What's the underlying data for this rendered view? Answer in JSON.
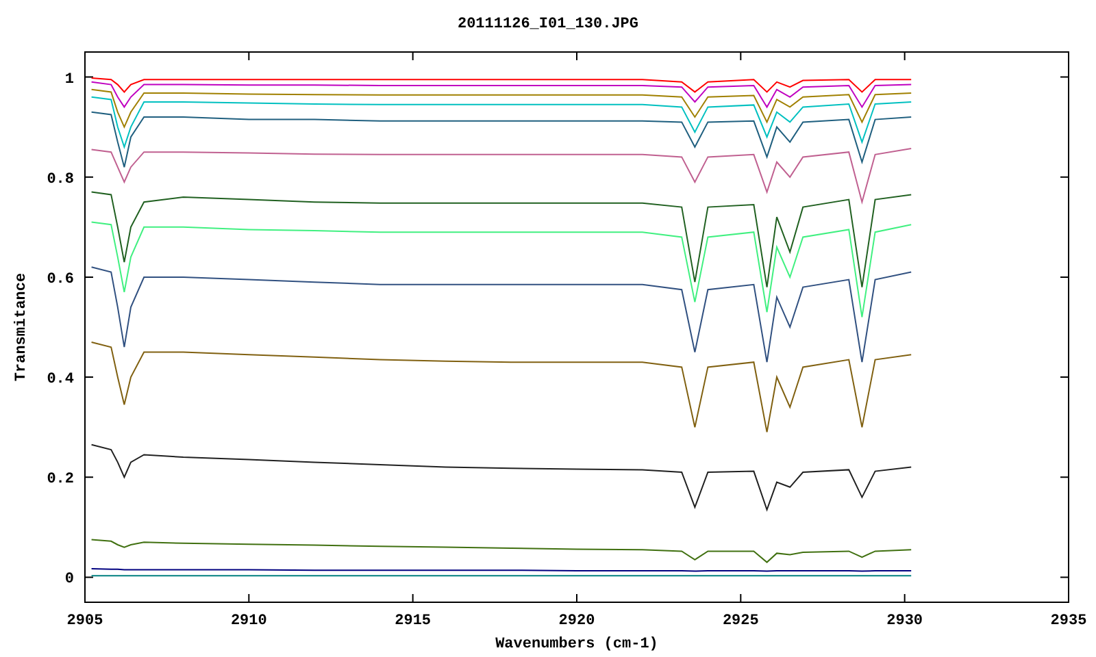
{
  "chart_data": {
    "type": "line",
    "title": "20111126_I01_130.JPG",
    "xlabel": "Wavenumbers (cm-1)",
    "ylabel": "Transmitance",
    "xlim": [
      2905,
      2935
    ],
    "ylim": [
      -0.05,
      1.05
    ],
    "xticks": [
      2905,
      2910,
      2915,
      2920,
      2925,
      2930,
      2935
    ],
    "yticks": [
      {
        "value": 0,
        "label": "0"
      },
      {
        "value": 0.2,
        "label": "0.2"
      },
      {
        "value": 0.4,
        "label": "0.4"
      },
      {
        "value": 0.6,
        "label": "0.6"
      },
      {
        "value": 0.8,
        "label": "0.8"
      },
      {
        "value": 1,
        "label": "1"
      }
    ],
    "x": [
      2905.2,
      2905.8,
      2906.0,
      2906.2,
      2906.4,
      2906.8,
      2908,
      2910,
      2912,
      2914,
      2916,
      2918,
      2920,
      2922,
      2923.2,
      2923.6,
      2924.0,
      2925.4,
      2925.8,
      2926.1,
      2926.5,
      2926.9,
      2928.3,
      2928.7,
      2929.1,
      2930.2
    ],
    "series": [
      {
        "color": "#ff0000",
        "values": [
          0.998,
          0.995,
          0.985,
          0.97,
          0.985,
          0.995,
          0.995,
          0.995,
          0.995,
          0.995,
          0.995,
          0.995,
          0.995,
          0.995,
          0.99,
          0.97,
          0.99,
          0.995,
          0.97,
          0.99,
          0.98,
          0.993,
          0.995,
          0.97,
          0.995,
          0.995
        ]
      },
      {
        "color": "#c000c0",
        "values": [
          0.99,
          0.985,
          0.96,
          0.94,
          0.96,
          0.985,
          0.985,
          0.984,
          0.984,
          0.983,
          0.983,
          0.983,
          0.983,
          0.983,
          0.98,
          0.95,
          0.98,
          0.983,
          0.94,
          0.975,
          0.96,
          0.98,
          0.983,
          0.94,
          0.983,
          0.985
        ]
      },
      {
        "color": "#a08000",
        "values": [
          0.975,
          0.97,
          0.93,
          0.9,
          0.93,
          0.968,
          0.968,
          0.966,
          0.965,
          0.964,
          0.964,
          0.964,
          0.964,
          0.964,
          0.96,
          0.92,
          0.96,
          0.963,
          0.91,
          0.955,
          0.94,
          0.96,
          0.965,
          0.91,
          0.965,
          0.968
        ]
      },
      {
        "color": "#00c0c0",
        "values": [
          0.96,
          0.955,
          0.9,
          0.86,
          0.9,
          0.95,
          0.95,
          0.948,
          0.946,
          0.945,
          0.945,
          0.945,
          0.945,
          0.945,
          0.94,
          0.89,
          0.94,
          0.944,
          0.88,
          0.93,
          0.91,
          0.94,
          0.946,
          0.87,
          0.946,
          0.95
        ]
      },
      {
        "color": "#1f5f7f",
        "values": [
          0.93,
          0.925,
          0.87,
          0.82,
          0.88,
          0.92,
          0.92,
          0.915,
          0.915,
          0.912,
          0.912,
          0.912,
          0.912,
          0.912,
          0.91,
          0.86,
          0.91,
          0.912,
          0.84,
          0.9,
          0.87,
          0.91,
          0.915,
          0.83,
          0.915,
          0.92
        ]
      },
      {
        "color": "#c06090",
        "values": [
          0.855,
          0.85,
          0.82,
          0.79,
          0.82,
          0.85,
          0.85,
          0.848,
          0.846,
          0.845,
          0.845,
          0.845,
          0.845,
          0.845,
          0.84,
          0.79,
          0.84,
          0.845,
          0.77,
          0.83,
          0.8,
          0.84,
          0.85,
          0.75,
          0.845,
          0.857
        ]
      },
      {
        "color": "#206020",
        "values": [
          0.77,
          0.765,
          0.7,
          0.63,
          0.7,
          0.75,
          0.76,
          0.755,
          0.75,
          0.748,
          0.748,
          0.748,
          0.748,
          0.748,
          0.74,
          0.59,
          0.74,
          0.745,
          0.58,
          0.72,
          0.65,
          0.74,
          0.755,
          0.58,
          0.755,
          0.765
        ]
      },
      {
        "color": "#40f080",
        "values": [
          0.71,
          0.705,
          0.64,
          0.57,
          0.64,
          0.7,
          0.7,
          0.695,
          0.693,
          0.69,
          0.69,
          0.69,
          0.69,
          0.69,
          0.68,
          0.55,
          0.68,
          0.69,
          0.53,
          0.66,
          0.6,
          0.68,
          0.695,
          0.52,
          0.69,
          0.705
        ]
      },
      {
        "color": "#305080",
        "values": [
          0.62,
          0.61,
          0.54,
          0.46,
          0.54,
          0.6,
          0.6,
          0.595,
          0.59,
          0.585,
          0.585,
          0.585,
          0.585,
          0.585,
          0.575,
          0.45,
          0.575,
          0.585,
          0.43,
          0.56,
          0.5,
          0.58,
          0.595,
          0.43,
          0.595,
          0.61
        ]
      },
      {
        "color": "#806010",
        "values": [
          0.47,
          0.46,
          0.4,
          0.345,
          0.4,
          0.45,
          0.45,
          0.445,
          0.44,
          0.435,
          0.432,
          0.43,
          0.43,
          0.43,
          0.42,
          0.3,
          0.42,
          0.43,
          0.29,
          0.4,
          0.34,
          0.42,
          0.435,
          0.3,
          0.435,
          0.445
        ]
      },
      {
        "color": "#202020",
        "values": [
          0.265,
          0.255,
          0.23,
          0.2,
          0.23,
          0.245,
          0.24,
          0.235,
          0.23,
          0.225,
          0.22,
          0.218,
          0.216,
          0.215,
          0.21,
          0.14,
          0.21,
          0.212,
          0.135,
          0.19,
          0.18,
          0.21,
          0.215,
          0.16,
          0.212,
          0.22
        ]
      },
      {
        "color": "#407010",
        "values": [
          0.075,
          0.072,
          0.065,
          0.06,
          0.065,
          0.07,
          0.068,
          0.066,
          0.064,
          0.062,
          0.06,
          0.058,
          0.056,
          0.055,
          0.052,
          0.035,
          0.052,
          0.052,
          0.03,
          0.048,
          0.045,
          0.05,
          0.052,
          0.04,
          0.052,
          0.055
        ]
      },
      {
        "color": "#000080",
        "values": [
          0.017,
          0.016,
          0.016,
          0.015,
          0.015,
          0.015,
          0.015,
          0.015,
          0.014,
          0.014,
          0.014,
          0.014,
          0.013,
          0.013,
          0.013,
          0.012,
          0.013,
          0.013,
          0.012,
          0.013,
          0.013,
          0.013,
          0.013,
          0.012,
          0.013,
          0.013
        ]
      },
      {
        "color": "#008080",
        "values": [
          0.003,
          0.003,
          0.003,
          0.003,
          0.003,
          0.003,
          0.003,
          0.003,
          0.003,
          0.003,
          0.003,
          0.003,
          0.003,
          0.003,
          0.003,
          0.003,
          0.003,
          0.003,
          0.003,
          0.003,
          0.003,
          0.003,
          0.003,
          0.003,
          0.003,
          0.003
        ]
      }
    ]
  }
}
